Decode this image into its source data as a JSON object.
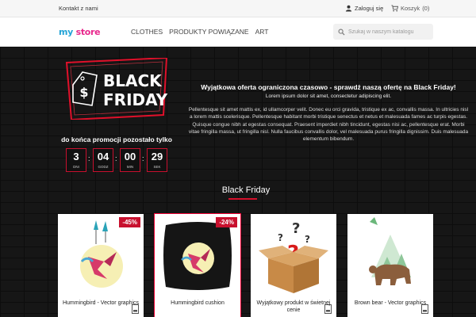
{
  "topbar": {
    "contact": "Kontakt z nami",
    "login": "Zaloguj się",
    "cart": "Koszyk",
    "cart_count": "(0)"
  },
  "header": {
    "logo_my": "my",
    "logo_store": "store",
    "nav": [
      "CLOTHES",
      "PRODUKTY POWIĄZANE",
      "ART"
    ],
    "search_placeholder": "Szukaj w naszym katalogu"
  },
  "hero": {
    "badge_line1": "BLACK",
    "badge_line2": "FRIDAY",
    "countdown_label": "do końca promocji pozostało tylko",
    "countdown": [
      {
        "value": "3",
        "unit": "DNI"
      },
      {
        "value": "04",
        "unit": "GODZ"
      },
      {
        "value": "00",
        "unit": "MIN"
      },
      {
        "value": "29",
        "unit": "SEK"
      }
    ],
    "promo_title": "Wyjątkowa oferta ograniczona czasowo - sprawdź naszą ofertę na Black Friday!",
    "promo_subtitle": "Lorem ipsum dolor sit amet, consectetur adipiscing elit.",
    "promo_body": "Pellentesque sit amet mattis ex, id ullamcorper velit. Donec eu orci gravida, tristique ex ac, convallis massa. In ultricies nisl a lorem mattis scelerisque. Pellentesque habitant morbi tristique senectus et netus et malesuada fames ac turpis egestas. Quisque congue nibh at egestas consequat. Praesent imperdiet nibh tincidunt, egestas nisi ac, pellentesque erat. Morbi vitae fringilla massa, ut fringilla nisl. Nulla faucibus convallis dolor, vel malesuada purus fringilla dignissim. Duis malesuada elementum bibendum."
  },
  "section": {
    "title": "Black Friday"
  },
  "products": [
    {
      "name": "Hummingbird - Vector graphics",
      "discount": "-45%",
      "icon": "hummingbird-vector"
    },
    {
      "name": "Hummingbird cushion",
      "discount": "-24%",
      "icon": "black-cushion"
    },
    {
      "name": "Wyjątkowy produkt w świetnej cenie",
      "discount": "",
      "icon": "mystery-box"
    },
    {
      "name": "Brown bear - Vector graphics",
      "discount": "",
      "icon": "brown-bear-vector"
    }
  ],
  "colors": {
    "accent": "#c8102e",
    "logo_blue": "#22a3d6",
    "logo_pink": "#e8278c"
  }
}
